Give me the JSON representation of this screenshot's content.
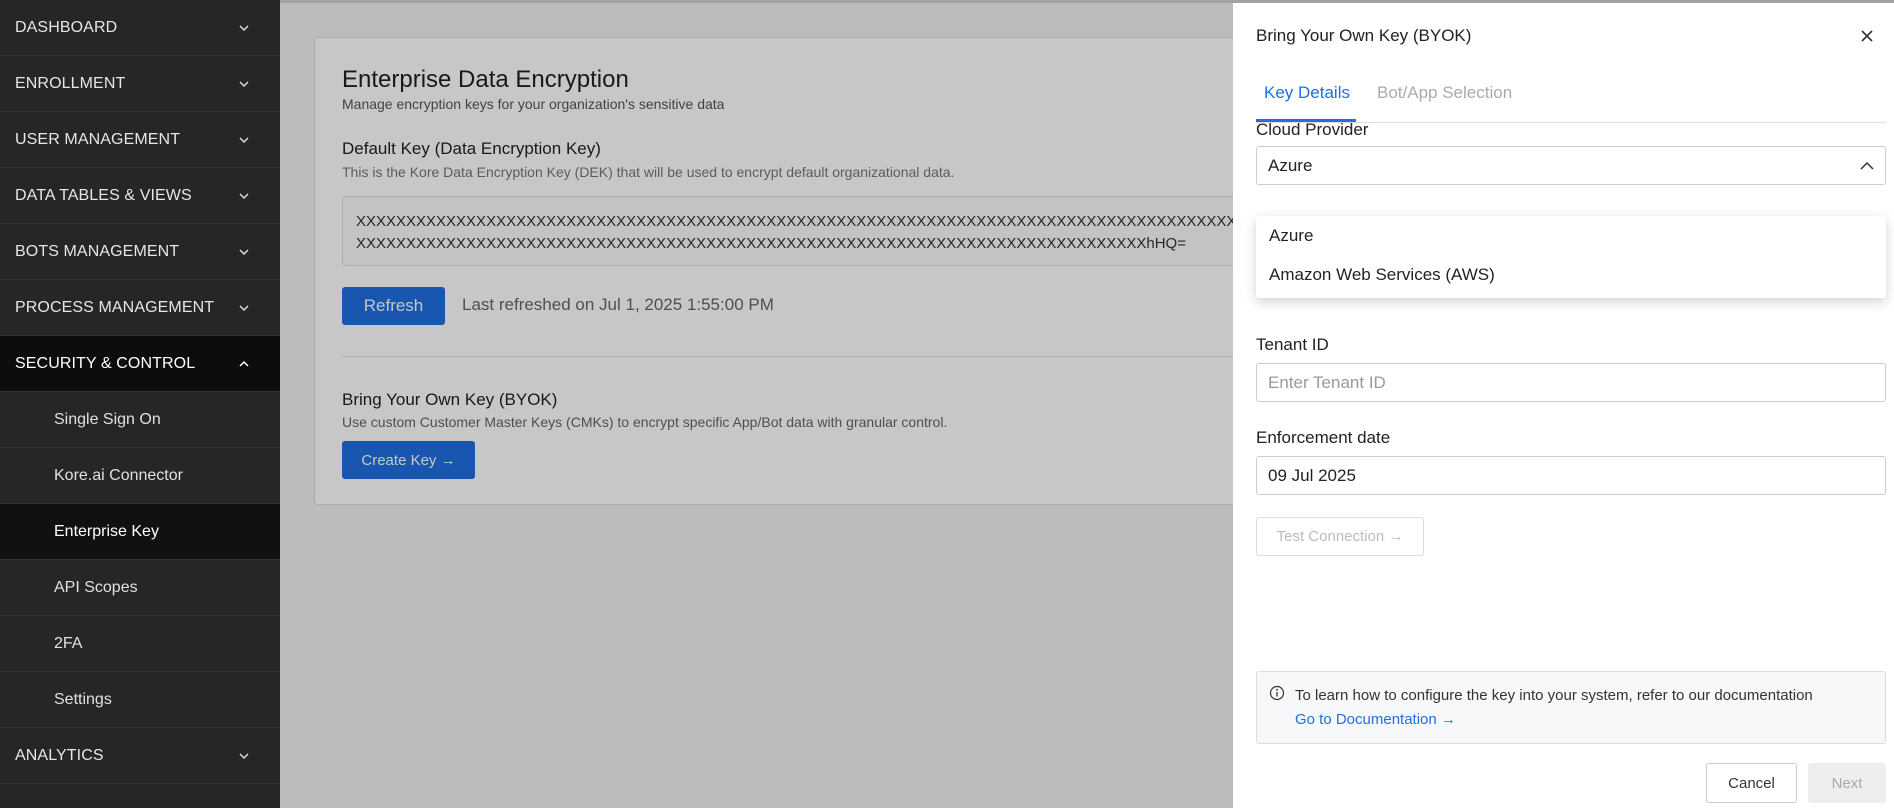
{
  "sidebar": {
    "items": [
      {
        "label": "DASHBOARD",
        "expanded": false
      },
      {
        "label": "ENROLLMENT",
        "expanded": false
      },
      {
        "label": "USER MANAGEMENT",
        "expanded": false
      },
      {
        "label": "DATA TABLES & VIEWS",
        "expanded": false
      },
      {
        "label": "BOTS MANAGEMENT",
        "expanded": false
      },
      {
        "label": "PROCESS MANAGEMENT",
        "expanded": false
      },
      {
        "label": "SECURITY & CONTROL",
        "expanded": true
      },
      {
        "label": "ANALYTICS",
        "expanded": false
      }
    ],
    "sub_items": [
      {
        "label": "Single Sign On"
      },
      {
        "label": "Kore.ai Connector"
      },
      {
        "label": "Enterprise Key"
      },
      {
        "label": "API Scopes"
      },
      {
        "label": "2FA"
      },
      {
        "label": "Settings"
      }
    ]
  },
  "main": {
    "title": "Enterprise Data Encryption",
    "subtitle": "Manage encryption keys for your organization's sensitive data",
    "dek_title": "Default Key (Data Encryption Key)",
    "dek_subtitle": "This is the Kore Data Encryption Key (DEK) that will be used to encrypt default organizational data.",
    "key_line1": "XXXXXXXXXXXXXXXXXXXXXXXXXXXXXXXXXXXXXXXXXXXXXXXXXXXXXXXXXXXXXXXXXXXXXXXXXXXXXXXXXXXXXXXXXXXXXXXX",
    "key_line2": "XXXXXXXXXXXXXXXXXXXXXXXXXXXXXXXXXXXXXXXXXXXXXXXXXXXXXXXXXXXXXXXXXXXXXXXXXXXXXXXhHQ=",
    "refresh_label": "Refresh",
    "last_refreshed": "Last refreshed on Jul 1, 2025 1:55:00 PM",
    "byok_title": "Bring Your Own Key (BYOK)",
    "byok_subtitle": "Use custom Customer Master Keys (CMKs) to encrypt specific App/Bot data with granular control.",
    "create_key_label": "Create Key →"
  },
  "drawer": {
    "title": "Bring Your Own Key (BYOK)",
    "tabs": [
      {
        "label": "Key Details",
        "active": true
      },
      {
        "label": "Bot/App Selection",
        "active": false
      }
    ],
    "cloud_provider_label": "Cloud Provider",
    "cloud_provider_value": "Azure",
    "cloud_provider_options": [
      "Azure",
      "Amazon Web Services (AWS)"
    ],
    "tenant_id_label": "Tenant ID",
    "tenant_id_placeholder": "Enter Tenant ID",
    "enforcement_label": "Enforcement date",
    "enforcement_value": "09 Jul 2025",
    "test_connection_label": "Test Connection →",
    "info_text": "To learn how to configure the key into your system, refer to our documentation",
    "info_link": "Go to Documentation →",
    "cancel_label": "Cancel",
    "next_label": "Next"
  },
  "colors": {
    "accent": "#1f6fe0",
    "sidebar_bg": "#262626"
  }
}
